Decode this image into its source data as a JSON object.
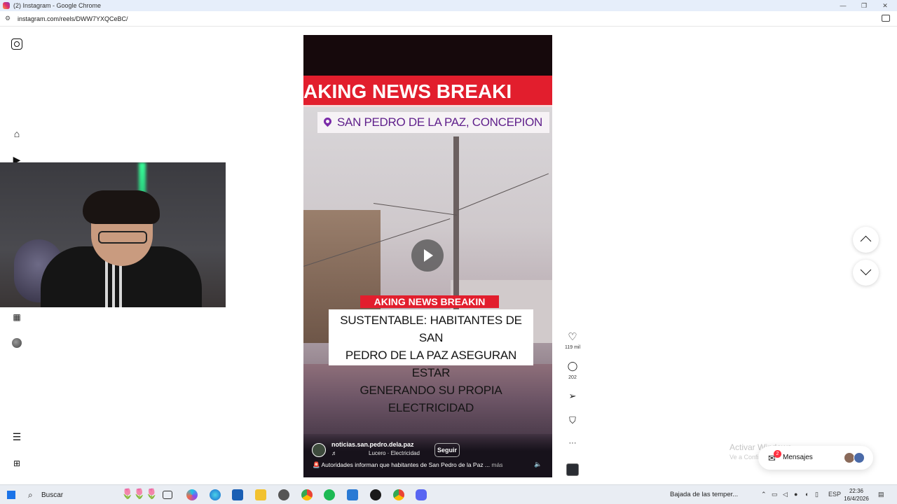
{
  "browser": {
    "window_title": "(2) Instagram - Google Chrome",
    "url": "instagram.com/reels/DWW7YXQCeBC/",
    "minimize_glyph": "—",
    "restore_glyph": "❐",
    "close_glyph": "✕"
  },
  "nav": {
    "items": [
      {
        "name": "instagram-logo-icon"
      },
      {
        "name": "home-icon"
      },
      {
        "name": "reels-icon"
      },
      {
        "name": "dashboard-icon"
      },
      {
        "name": "profile-avatar"
      },
      {
        "name": "menu-icon"
      },
      {
        "name": "also-from-meta-icon"
      }
    ]
  },
  "reel": {
    "banner_text": "AKING NEWS   BREAKI",
    "location": "SAN PEDRO DE LA PAZ, CONCEPION",
    "small_banner_text": "AKING NEWS   BREAKIN",
    "headline_line1": "SUSTENTABLE: HABITANTES DE SAN",
    "headline_line2": "PEDRO DE LA PAZ ASEGURAN ESTAR",
    "headline_line3": "GENERANDO SU PROPIA ELECTRICIDAD",
    "account": "noticias.san.pedro.dela.paz",
    "music_glyph": "♬",
    "audio": "Lucero · Electricidad",
    "follow_label": "Seguir",
    "caption_emoji": "🚨",
    "caption": "Autoridades informan que habitantes de San Pedro de la Paz ...",
    "caption_more": "más",
    "mute_glyph": "🔈"
  },
  "actions": {
    "like_glyph": "♡",
    "like_count": "119 mil",
    "comment_glyph": "◯",
    "comment_count": "202",
    "share_glyph": "➢",
    "save_glyph": "⛉",
    "more_glyph": "···"
  },
  "overlay": {
    "activate_title": "Activar Windows",
    "activate_sub": "Ve a Configuración para activar Windows."
  },
  "messages": {
    "label": "Mensajes",
    "badge": "2",
    "icon_glyph": "✉"
  },
  "taskbar": {
    "search_label": "Buscar",
    "flowers": "🌷🌷🌷",
    "weather": "Bajada de las temper...",
    "language": "ESP",
    "time": "22:36",
    "date": "16/4/2026",
    "chevron_glyph": "⌃"
  },
  "colors": {
    "breaking_red": "#e21e2d",
    "location_purple": "#5f1f8b",
    "badge_red": "#ff3040"
  }
}
